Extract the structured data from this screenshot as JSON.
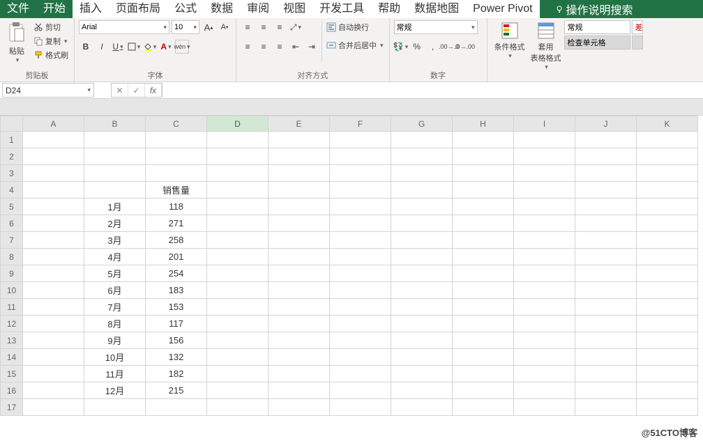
{
  "menu": {
    "file": "文件",
    "home": "开始",
    "insert": "插入",
    "pageLayout": "页面布局",
    "formulas": "公式",
    "data": "数据",
    "review": "审阅",
    "view": "视图",
    "developer": "开发工具",
    "help": "帮助",
    "dataMap": "数据地图",
    "powerPivot": "Power Pivot",
    "tellMe": "操作说明搜索"
  },
  "clipboard": {
    "paste": "粘贴",
    "cut": "剪切",
    "copy": "复制",
    "formatPainter": "格式刷",
    "groupLabel": "剪贴板"
  },
  "font": {
    "fontName": "Arial",
    "fontSize": "10",
    "groupLabel": "字体",
    "bold": "B",
    "italic": "I",
    "underline": "U",
    "phonetic": "wén"
  },
  "alignment": {
    "wrap": "自动换行",
    "merge": "合并后居中",
    "groupLabel": "对齐方式"
  },
  "number": {
    "format": "常规",
    "groupLabel": "数字"
  },
  "styles": {
    "conditional": "条件格式",
    "tableFormat": "套用\n表格格式",
    "normal": "常规",
    "checkCell": "检查单元格",
    "extra": "差"
  },
  "nameBox": "D24",
  "columns": [
    "A",
    "B",
    "C",
    "D",
    "E",
    "F",
    "G",
    "H",
    "I",
    "J",
    "K"
  ],
  "rows": [
    "1",
    "2",
    "3",
    "4",
    "5",
    "6",
    "7",
    "8",
    "9",
    "10",
    "11",
    "12",
    "13",
    "14",
    "15",
    "16",
    "17"
  ],
  "cells": {
    "C4": "销售量",
    "B5": "1月",
    "C5": "118",
    "B6": "2月",
    "C6": "271",
    "B7": "3月",
    "C7": "258",
    "B8": "4月",
    "C8": "201",
    "B9": "5月",
    "C9": "254",
    "B10": "6月",
    "C10": "183",
    "B11": "7月",
    "C11": "153",
    "B12": "8月",
    "C12": "117",
    "B13": "9月",
    "C13": "156",
    "B14": "10月",
    "C14": "132",
    "B15": "11月",
    "C15": "182",
    "B16": "12月",
    "C16": "215"
  },
  "watermark": "@51CTO博客"
}
